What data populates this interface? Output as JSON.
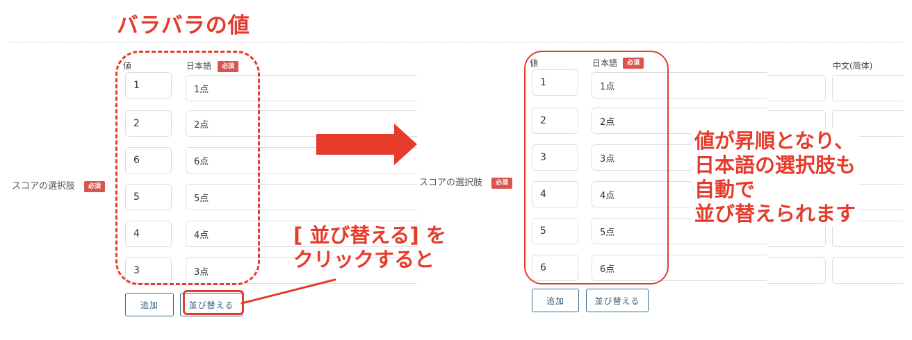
{
  "heading": "バラバラの値",
  "before": {
    "field_label": "スコアの選択肢",
    "required_badge": "必須",
    "col_value": "値",
    "col_japanese": "日本語",
    "rows": [
      {
        "value": "1",
        "japanese": "1点"
      },
      {
        "value": "2",
        "japanese": "2点"
      },
      {
        "value": "6",
        "japanese": "6点"
      },
      {
        "value": "5",
        "japanese": "5点"
      },
      {
        "value": "4",
        "japanese": "4点"
      },
      {
        "value": "3",
        "japanese": "3点"
      }
    ],
    "add_label": "追加",
    "sort_label": "並び替える"
  },
  "after": {
    "field_label": "スコアの選択肢",
    "required_badge": "必須",
    "col_value": "値",
    "col_japanese": "日本語",
    "col_chinese": "中文(简体)",
    "rows": [
      {
        "value": "1",
        "japanese": "1点"
      },
      {
        "value": "2",
        "japanese": "2点"
      },
      {
        "value": "3",
        "japanese": "3点"
      },
      {
        "value": "4",
        "japanese": "4点"
      },
      {
        "value": "5",
        "japanese": "5点"
      },
      {
        "value": "6",
        "japanese": "6点"
      }
    ],
    "add_label": "追加",
    "sort_label": "並び替える"
  },
  "annotation_click": [
    "[ 並び替える] を",
    "クリックすると"
  ],
  "annotation_result": [
    "値が昇順となり、",
    "日本語の選択肢も",
    "自動で",
    "並び替えられます"
  ],
  "accent_color": "#e63a2a",
  "badge_color": "#d9534f",
  "button_border_color": "#2f6f8f"
}
